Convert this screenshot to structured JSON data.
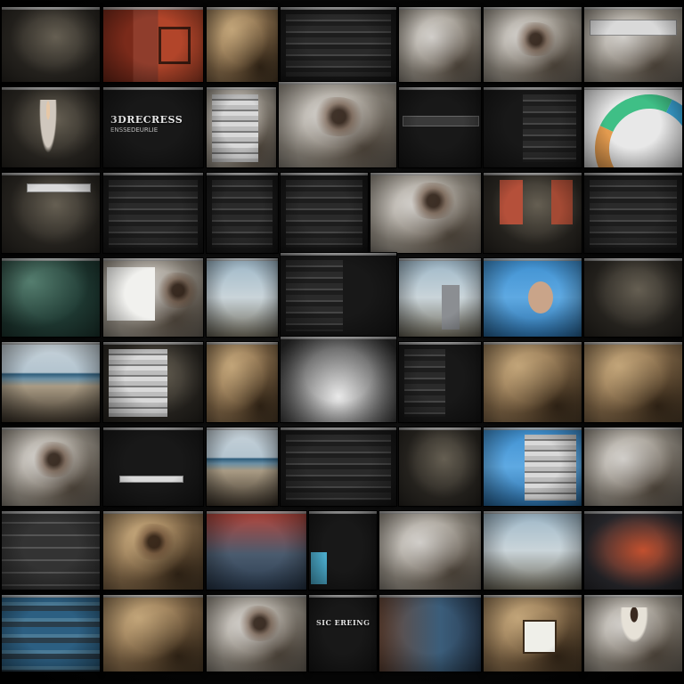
{
  "collage": {
    "rows": 8,
    "columns": 7,
    "texts": {
      "r2c2_title": "3DRECRESS",
      "r2c2_sub": "ENSSEDEURLIE",
      "r8c4_title": "SIC EREING"
    },
    "colors": {
      "background": "#050505",
      "accent_orange": "#e39b4f",
      "accent_green": "#3fbf86",
      "accent_blue": "#3aa6d8",
      "sky_blue": "#5ea9e2"
    }
  }
}
